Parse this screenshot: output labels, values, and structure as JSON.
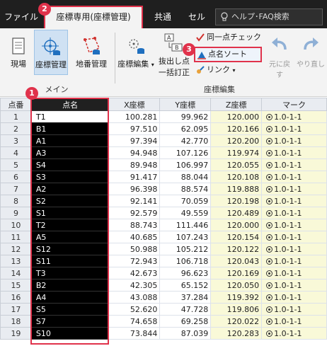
{
  "tabs": {
    "file": "ファイル",
    "active": "座標専用(座標管理)",
    "common": "共通",
    "cell": "セル"
  },
  "help": {
    "placeholder": "ヘルプ･FAQ検索"
  },
  "ribbon": {
    "genba": "現場",
    "zahyo_kanri": "座標管理",
    "chiban_kanri": "地番管理",
    "zahyo_hensyu": "座標編集",
    "nukidashi_line1": "抜出し点",
    "nukidashi_line2": "一括訂正",
    "doitsu_check": "同一点チェック",
    "tenmei_sort": "点名ソート",
    "link": "リンク",
    "undo": "元に戻す",
    "redo": "やり直し",
    "group_main": "メイン",
    "group_edit": "座標編集"
  },
  "badges": [
    "1",
    "2",
    "3"
  ],
  "table": {
    "headers": [
      "点番",
      "点名",
      "X座標",
      "Y座標",
      "Z座標",
      "マーク"
    ],
    "rows": [
      {
        "no": "1",
        "name": "T1",
        "x": "100.281",
        "y": "99.962",
        "z": "120.000",
        "mark": "1.0-1-1"
      },
      {
        "no": "2",
        "name": "B1",
        "x": "97.510",
        "y": "62.095",
        "z": "120.166",
        "mark": "1.0-1-1"
      },
      {
        "no": "3",
        "name": "A1",
        "x": "97.394",
        "y": "42.770",
        "z": "120.200",
        "mark": "1.0-1-1"
      },
      {
        "no": "4",
        "name": "A3",
        "x": "94.948",
        "y": "107.126",
        "z": "119.974",
        "mark": "1.0-1-1"
      },
      {
        "no": "5",
        "name": "S4",
        "x": "89.948",
        "y": "106.997",
        "z": "120.055",
        "mark": "1.0-1-1"
      },
      {
        "no": "6",
        "name": "S3",
        "x": "91.417",
        "y": "88.044",
        "z": "120.108",
        "mark": "1.0-1-1"
      },
      {
        "no": "7",
        "name": "A2",
        "x": "96.398",
        "y": "88.574",
        "z": "119.888",
        "mark": "1.0-1-1"
      },
      {
        "no": "8",
        "name": "S2",
        "x": "92.141",
        "y": "70.059",
        "z": "120.198",
        "mark": "1.0-1-1"
      },
      {
        "no": "9",
        "name": "S1",
        "x": "92.579",
        "y": "49.559",
        "z": "120.489",
        "mark": "1.0-1-1"
      },
      {
        "no": "10",
        "name": "T2",
        "x": "88.743",
        "y": "111.446",
        "z": "120.000",
        "mark": "1.0-1-1"
      },
      {
        "no": "11",
        "name": "A5",
        "x": "40.685",
        "y": "107.243",
        "z": "120.154",
        "mark": "1.0-1-1"
      },
      {
        "no": "12",
        "name": "S12",
        "x": "50.988",
        "y": "105.212",
        "z": "120.122",
        "mark": "1.0-1-1"
      },
      {
        "no": "13",
        "name": "S11",
        "x": "72.943",
        "y": "106.718",
        "z": "120.043",
        "mark": "1.0-1-1"
      },
      {
        "no": "14",
        "name": "T3",
        "x": "42.673",
        "y": "96.623",
        "z": "120.169",
        "mark": "1.0-1-1"
      },
      {
        "no": "15",
        "name": "B2",
        "x": "42.305",
        "y": "65.152",
        "z": "120.050",
        "mark": "1.0-1-1"
      },
      {
        "no": "16",
        "name": "A4",
        "x": "43.088",
        "y": "37.284",
        "z": "119.392",
        "mark": "1.0-1-1"
      },
      {
        "no": "17",
        "name": "S5",
        "x": "52.620",
        "y": "47.728",
        "z": "119.806",
        "mark": "1.0-1-1"
      },
      {
        "no": "18",
        "name": "S7",
        "x": "74.658",
        "y": "69.258",
        "z": "120.022",
        "mark": "1.0-1-1"
      },
      {
        "no": "19",
        "name": "S10",
        "x": "73.844",
        "y": "87.039",
        "z": "120.283",
        "mark": "1.0-1-1"
      }
    ]
  }
}
